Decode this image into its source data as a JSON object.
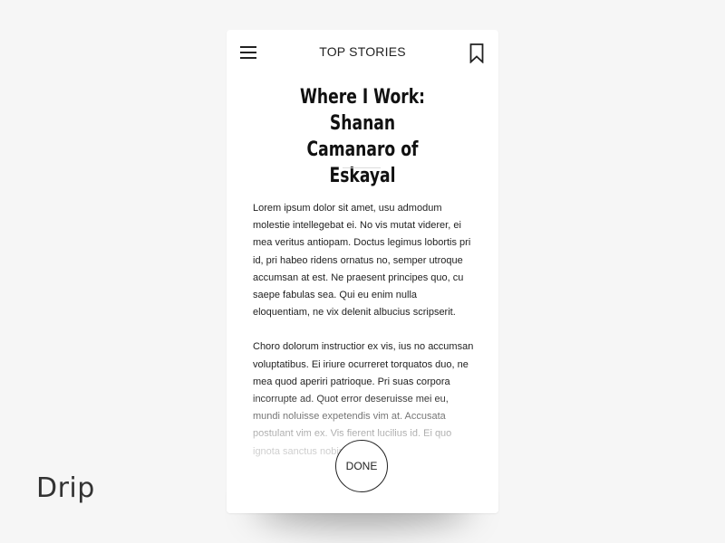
{
  "header": {
    "title": "TOP STORIES",
    "menu_icon": "hamburger-menu-icon",
    "bookmark_icon": "bookmark-icon"
  },
  "article": {
    "headline": "Where I Work: Shanan\nCamanaro of Eskayal",
    "paragraphs": [
      "Lorem ipsum dolor sit amet, usu admodum molestie intellegebat ei. No vis mutat viderer, ei mea veritus antiopam. Doctus legimus lobortis pri id, pri habeo ridens ornatus no, semper utroque accumsan at est. Ne praesent principes quo, cu saepe fabulas sea. Qui eu enim nulla eloquentiam, ne vix delenit albucius scripserit.",
      "Choro dolorum instructior ex vis, ius no accumsan voluptatibus. Ei iriure ocurreret torquatos duo, ne mea quod aperiri patrioque. Pri suas corpora incorrupte ad. Quot error deseruisse mei eu, mundi noluisse expetendis vim at. Accusata postulant vim ex. Vis fierent lucilius id. Ei quo ignota sanctus nobis."
    ]
  },
  "done_label": "DONE",
  "brand": "Drip",
  "colors": {
    "background": "#f6f6f6",
    "card": "#ffffff",
    "text": "#222222"
  }
}
